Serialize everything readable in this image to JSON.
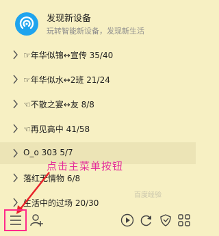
{
  "device": {
    "title": "发现新设备",
    "subtitle": "玩转智能新设备，发现新生活"
  },
  "groups": [
    {
      "label": "☞年华似锦↔宣传 35/40",
      "selected": false
    },
    {
      "label": "☞年华似水↔2班 21/24",
      "selected": false
    },
    {
      "label": "☜不散之宴↔友 8/8",
      "selected": false
    },
    {
      "label": "☜再见高中 41/58",
      "selected": false
    },
    {
      "label": "O_o 303 5/7",
      "selected": true
    },
    {
      "label": "落红无情物 6/8",
      "selected": false
    },
    {
      "label": "生活中的过场 20/30",
      "selected": false
    }
  ],
  "annotation": "点击主菜单按钮",
  "watermark": "百度经验",
  "icons": {
    "main_menu": "hamburger-menu-icon",
    "add_contact": "add-contact-icon",
    "play": "play-icon",
    "refresh": "refresh-icon",
    "shield": "shield-icon",
    "apps": "apps-grid-icon"
  },
  "colors": {
    "background": "#f7f0c3",
    "selected_row": "#ece4b6",
    "device_logo": "#1fa4ee",
    "annotation": "#e52c9a",
    "highlight": "#ff2a8a"
  }
}
